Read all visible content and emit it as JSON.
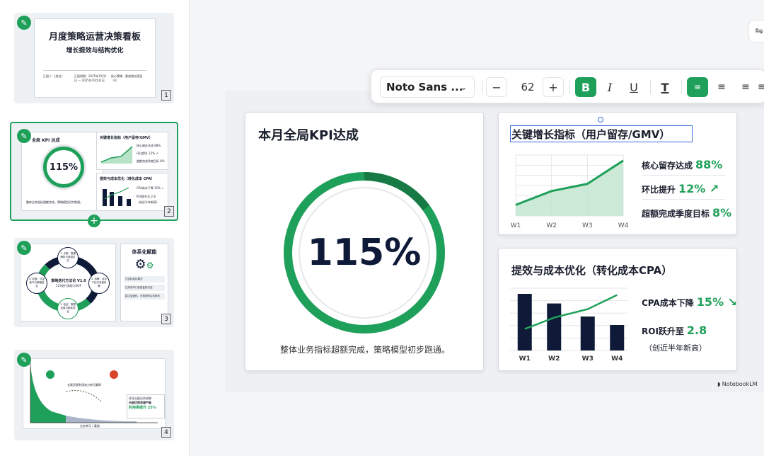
{
  "sidebar": {
    "slides": [
      {
        "number": "1",
        "title": "月度策略运营决策看板",
        "subtitle": "增长提效与结构优化",
        "meta": [
          "汇报人：[姓名]",
          "汇报周期：2025年10月1日 — 2025年10月31日",
          "核心策略：渠道增长提速（A）",
          "部门：增长团队"
        ]
      },
      {
        "number": "2",
        "kpi_title": "全局 KPI 达成",
        "kpi_value": "115%",
        "kpi_caption": "整体业务指标超额完成，策略模型初步跑通。",
        "growth_title": "关键增长指标（用户留存/GMV）",
        "growth_lines": [
          "核心留存达成 88%",
          "环比提升 12% ↗",
          "超额完成季度目标 8%"
        ],
        "cost_title": "提效与成本优化（转化成本 CPA）",
        "cost_lines": [
          "CPA成本下降 15% ↘",
          "ROI跃升至 2.8",
          "（创近半年新高）"
        ]
      },
      {
        "number": "3",
        "center_title": "策略迭代方法论 V1.0",
        "center_sub": "123迭代流程与SOP",
        "steps": [
          "1. 诊断：数据解析与瓶颈定位",
          "2. 拆解：目标下钻与变量拆解",
          "3. 验证：数据复盘与精准验证",
          "4. 复盘：沉淀迭代与策略进化"
        ],
        "side_title": "体系化赋能",
        "side_items": [
          "沉淀标准化模式",
          "已形成专门经验复用沉淀",
          "建立复盘化、可规则的实务体系"
        ]
      },
      {
        "number": "4",
        "chart_note": "长尾资源利用效力单元解释",
        "ylabel": "投入产出 / 能力 (ROI)",
        "xlabel": "业务单元 / 渠道",
        "box_lines": [
          "优化分配后的成果",
          "头部优质资源产能",
          "利用率提升 25%"
        ]
      }
    ]
  },
  "toolbar": {
    "font_name": "Noto Sans ...",
    "font_size": "62",
    "minus": "−",
    "plus": "+",
    "bold": "B",
    "italic": "I",
    "underline": "U",
    "text_color": "T"
  },
  "slide": {
    "kpi_title": "本月全局KPI达成",
    "kpi_value": "115%",
    "kpi_caption": "整体业务指标超额完成，策略模型初步跑通。",
    "growth_title": "关键增长指标（用户留存/GMV）",
    "growth_stats": [
      {
        "label": "核心留存达成",
        "value": "88%"
      },
      {
        "label": "环比提升",
        "value": "12% ↗"
      },
      {
        "label": "超额完成季度目标",
        "value": "8%"
      }
    ],
    "cost_title": "提效与成本优化（转化成本CPA）",
    "cost_stats": [
      {
        "label": "CPA成本下降",
        "value": "15% ↘"
      },
      {
        "label": "ROI跃升至",
        "value": "2.8"
      },
      {
        "label": "（创近半年新高）",
        "value": ""
      }
    ],
    "watermark": "NotebookLM"
  },
  "chart_data": [
    {
      "type": "line",
      "title": "关键增长指标（用户留存/GMV）",
      "categories": [
        "W1",
        "W2",
        "W3",
        "W4"
      ],
      "values": [
        20,
        45,
        58,
        100
      ],
      "ylim": [
        0,
        110
      ],
      "grid": true
    },
    {
      "type": "bar",
      "title": "提效与成本优化（转化成本CPA）",
      "categories": [
        "W1",
        "W2",
        "W3",
        "W4"
      ],
      "series": [
        {
          "type": "bar",
          "values": [
            100,
            83,
            60,
            45
          ]
        },
        {
          "type": "line",
          "values": [
            38,
            58,
            73,
            98
          ]
        }
      ],
      "ylim": [
        0,
        110
      ],
      "grid": true
    },
    {
      "type": "pie",
      "title": "本月全局KPI达成",
      "values": [
        100,
        15
      ],
      "label": "115%"
    }
  ],
  "colors": {
    "accent": "#1fa05a",
    "dark": "#0f1a38"
  }
}
